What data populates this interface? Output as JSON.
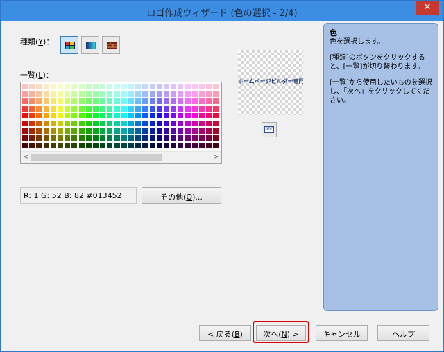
{
  "window": {
    "title": "ロゴ作成ウィザード (色の選択 - 2/4)",
    "close_glyph": "✕"
  },
  "type_label": {
    "text": "種類(",
    "key": "Y",
    "tail": ")："
  },
  "list_label": {
    "text": "一覧(",
    "key": "L",
    "tail": ")："
  },
  "type_buttons": [
    {
      "name": "palette-type",
      "selected": true
    },
    {
      "name": "gradient-type",
      "selected": false
    },
    {
      "name": "image-type",
      "selected": false
    }
  ],
  "rgb_text": "R:  1 G: 52 B: 82  #013452",
  "other_button": {
    "text": "その他(",
    "key": "O",
    "tail": ")..."
  },
  "preview_text": "ホームページビルダー専門学校",
  "abc_icon": "abc",
  "help": {
    "heading": "色",
    "line1": "色を選択します。",
    "para2": "[種類]のボタンをクリックすると、[一覧]が切り替わります。",
    "para3": "[一覧]から使用したいものを選択し、「次へ」をクリックしてください。"
  },
  "buttons": {
    "back": {
      "text": "< 戻る(",
      "key": "B",
      "tail": ")"
    },
    "next": {
      "text": "次へ(",
      "key": "N",
      "tail": ") >"
    },
    "cancel": "キャンセル",
    "help": "ヘルプ"
  },
  "scroll": {
    "left": "<",
    "right": ">"
  },
  "colors": {
    "titlebar": "#3c8ee4",
    "help_panel": "#a7c1e6",
    "highlight": "#e00000"
  }
}
